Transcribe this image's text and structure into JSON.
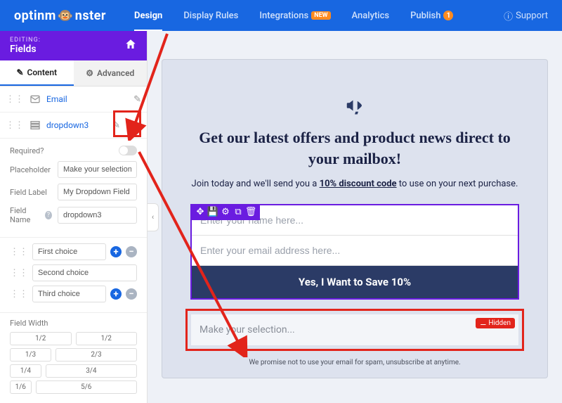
{
  "brand": "optinmonster",
  "topnav": {
    "design": "Design",
    "rules": "Display Rules",
    "integrations": "Integrations",
    "integrations_badge": "NEW",
    "analytics": "Analytics",
    "publish": "Publish",
    "publish_count": "1",
    "support": "Support"
  },
  "editing": {
    "label": "EDITING:",
    "value": "Fields"
  },
  "tabs": {
    "content": "Content",
    "advanced": "Advanced"
  },
  "fields": {
    "email": "Email",
    "dropdown": "dropdown3"
  },
  "props": {
    "required_label": "Required?",
    "placeholder_label": "Placeholder",
    "placeholder_value": "Make your selection...",
    "fieldlabel_label": "Field Label",
    "fieldlabel_value": "My Dropdown Field",
    "fieldname_label": "Field Name",
    "fieldname_value": "dropdown3"
  },
  "choices": [
    "First choice",
    "Second choice",
    "Third choice"
  ],
  "width": {
    "label": "Field Width",
    "rows": [
      [
        "1/2",
        "1/2"
      ],
      [
        "1/3",
        "2/3"
      ],
      [
        "1/4",
        "3/4"
      ],
      [
        "1/6",
        "5/6"
      ]
    ]
  },
  "preview": {
    "headline": "Get our latest offers and product news direct to your mailbox!",
    "sub_pre": "Join today and we'll send you a ",
    "sub_u": "10% discount code",
    "sub_post": " to use on your next purchase.",
    "name_ph": "Enter your name here...",
    "email_ph": "Enter your email address here...",
    "cta": "Yes, I Want to Save 10%",
    "dd_ph": "Make your selection...",
    "hidden": "Hidden",
    "footnote": "We promise not to use your email for spam, unsubscribe at anytime."
  }
}
